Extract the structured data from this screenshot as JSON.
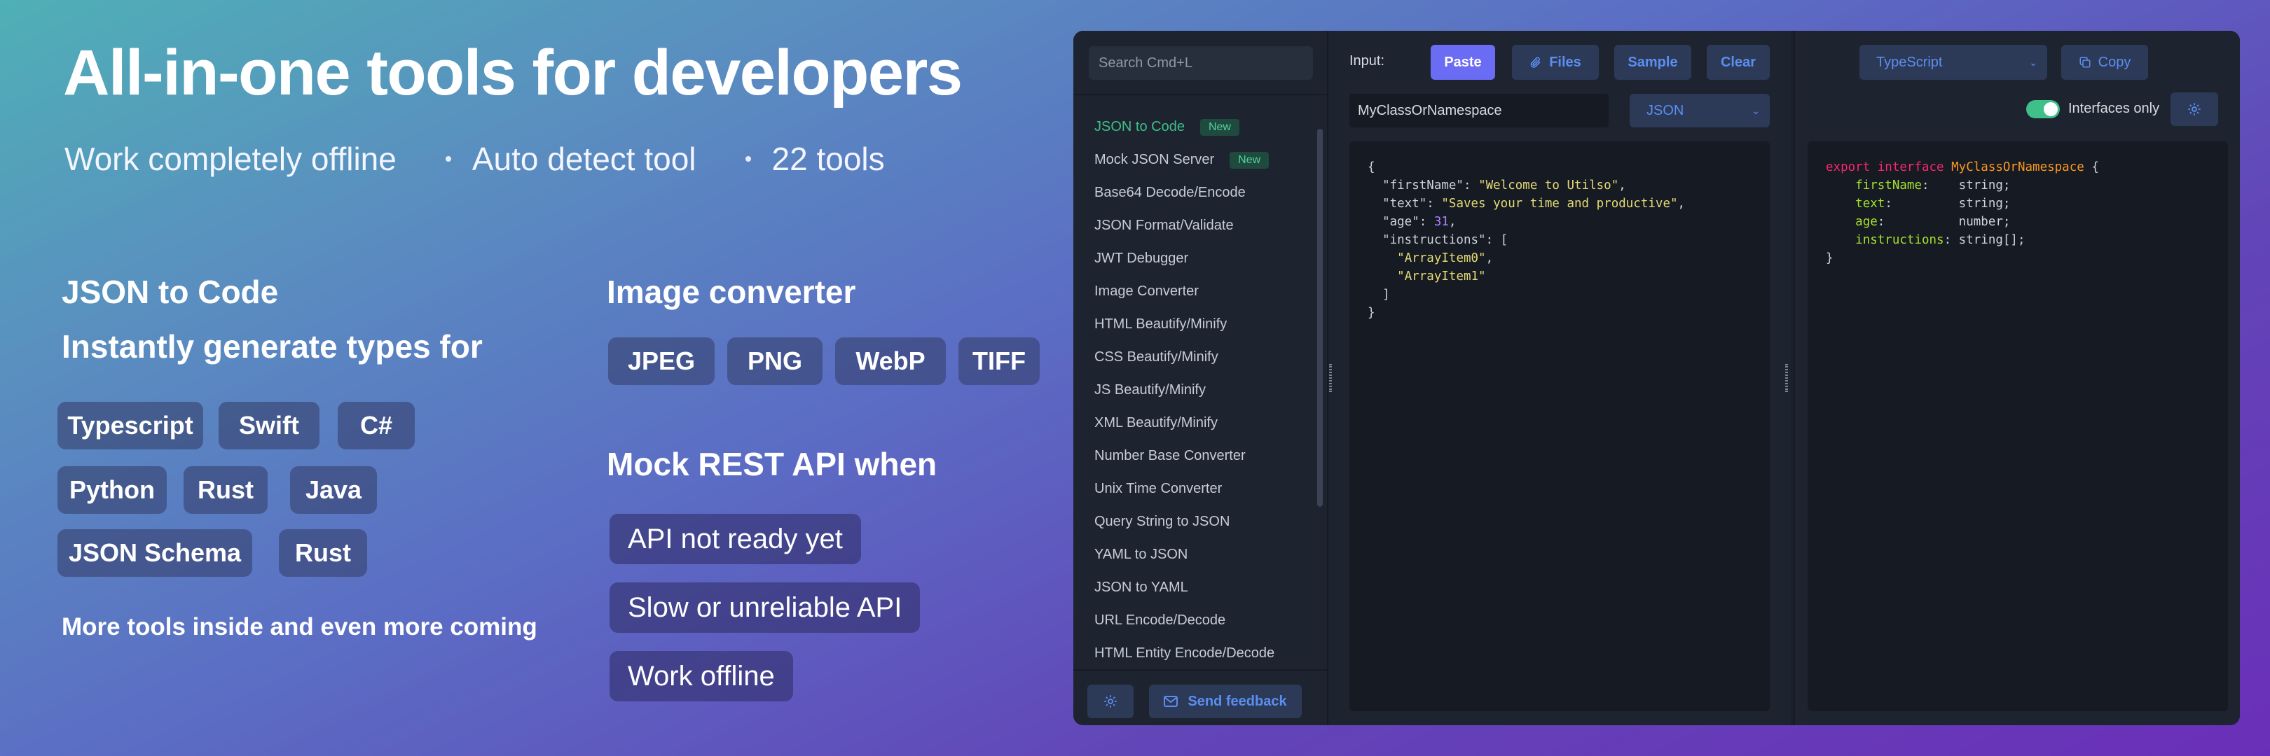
{
  "hero": {
    "title": "All-in-one tools for developers",
    "features": [
      "Work completely offline",
      "Auto detect tool",
      "22 tools"
    ]
  },
  "json_to_code": {
    "heading": "JSON to Code",
    "subheading": "Instantly generate types for",
    "languages": [
      "Typescript",
      "Swift",
      "C#",
      "Python",
      "Rust",
      "Java",
      "JSON Schema",
      "Rust"
    ]
  },
  "image_converter": {
    "heading": "Image converter",
    "formats": [
      "JPEG",
      "PNG",
      "WebP",
      "TIFF"
    ]
  },
  "mock_api": {
    "heading": "Mock REST API when",
    "reasons": [
      "API not ready yet",
      "Slow or unreliable API",
      "Work offline"
    ]
  },
  "more_tools": "More tools inside and even more coming",
  "app": {
    "search_placeholder": "Search Cmd+L",
    "nav": [
      {
        "label": "JSON to Code",
        "badge": "New",
        "active": true
      },
      {
        "label": "Mock JSON Server",
        "badge": "New"
      },
      {
        "label": "Base64 Decode/Encode"
      },
      {
        "label": "JSON Format/Validate"
      },
      {
        "label": "JWT Debugger"
      },
      {
        "label": "Image Converter"
      },
      {
        "label": "HTML Beautify/Minify"
      },
      {
        "label": "CSS Beautify/Minify"
      },
      {
        "label": "JS Beautify/Minify"
      },
      {
        "label": "XML Beautify/Minify"
      },
      {
        "label": "Number Base Converter"
      },
      {
        "label": "Unix Time Converter"
      },
      {
        "label": "Query String to JSON"
      },
      {
        "label": "YAML to JSON"
      },
      {
        "label": "JSON to YAML"
      },
      {
        "label": "URL Encode/Decode"
      },
      {
        "label": "HTML Entity Encode/Decode"
      }
    ],
    "feedback_label": "Send feedback",
    "input_label": "Input:",
    "buttons": {
      "paste": "Paste",
      "files": "Files",
      "sample": "Sample",
      "clear": "Clear",
      "copy": "Copy"
    },
    "class_name_value": "MyClassOrNamespace",
    "input_format": "JSON",
    "output_language": "TypeScript",
    "interfaces_only_label": "Interfaces only",
    "interfaces_only": true,
    "input_code": {
      "firstName_key": "\"firstName\"",
      "firstName_val": "\"Welcome to Utilso\"",
      "text_key": "\"text\"",
      "text_val": "\"Saves your time and productive\"",
      "age_key": "\"age\"",
      "age_val": "31",
      "instructions_key": "\"instructions\"",
      "item0": "\"ArrayItem0\"",
      "item1": "\"ArrayItem1\""
    },
    "output_code": {
      "export": "export",
      "interface": "interface",
      "name": "MyClassOrNamespace",
      "fields": [
        {
          "name": "firstName",
          "type": "string;"
        },
        {
          "name": "text",
          "type": "string;"
        },
        {
          "name": "age",
          "type": "number;"
        },
        {
          "name": "instructions",
          "type": "string[];"
        }
      ]
    }
  },
  "colors": {
    "accent": "#6b6cf4",
    "link": "#5b8ef0",
    "success": "#3fbf8a",
    "panel": "#1d232f",
    "code_bg": "#151a23"
  }
}
